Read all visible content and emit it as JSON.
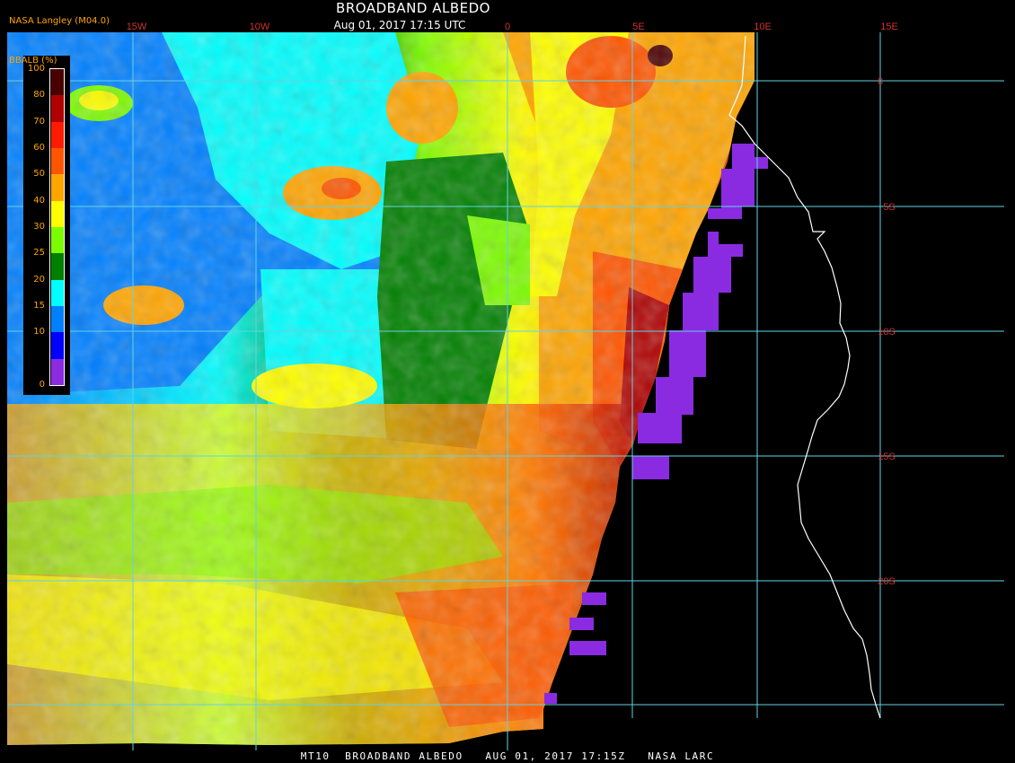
{
  "header": {
    "title": "BROADBAND ALBEDO",
    "subtitle": "Aug 01, 2017 17:15 UTC",
    "source": "NASA Langley (M04.0)"
  },
  "footer": "MT10  BROADBAND ALBEDO   AUG 01, 2017 17:15Z   NASA LARC",
  "legend": {
    "unit": "BBALB (%)",
    "ticks": [
      "100",
      "80",
      "70",
      "60",
      "50",
      "40",
      "30",
      "25",
      "20",
      "15",
      "10",
      "0"
    ],
    "colors": [
      "#4a0000",
      "#b00000",
      "#ff1a00",
      "#ff5500",
      "#ffa500",
      "#ffff00",
      "#7cfc00",
      "#008000",
      "#00ffff",
      "#0080ff",
      "#0000ff",
      "#8a2be2"
    ]
  },
  "map": {
    "lon_labels": [
      "15W",
      "10W",
      "0",
      "5E",
      "10E",
      "15E"
    ],
    "lat_labels": [
      "0",
      "5S",
      "10S",
      "15S",
      "20S"
    ],
    "grid_color": "#5fd3e6",
    "coastline_color": "#ffffff",
    "lon_label_color": "#d03030",
    "lat_label_color": "#d03030"
  }
}
